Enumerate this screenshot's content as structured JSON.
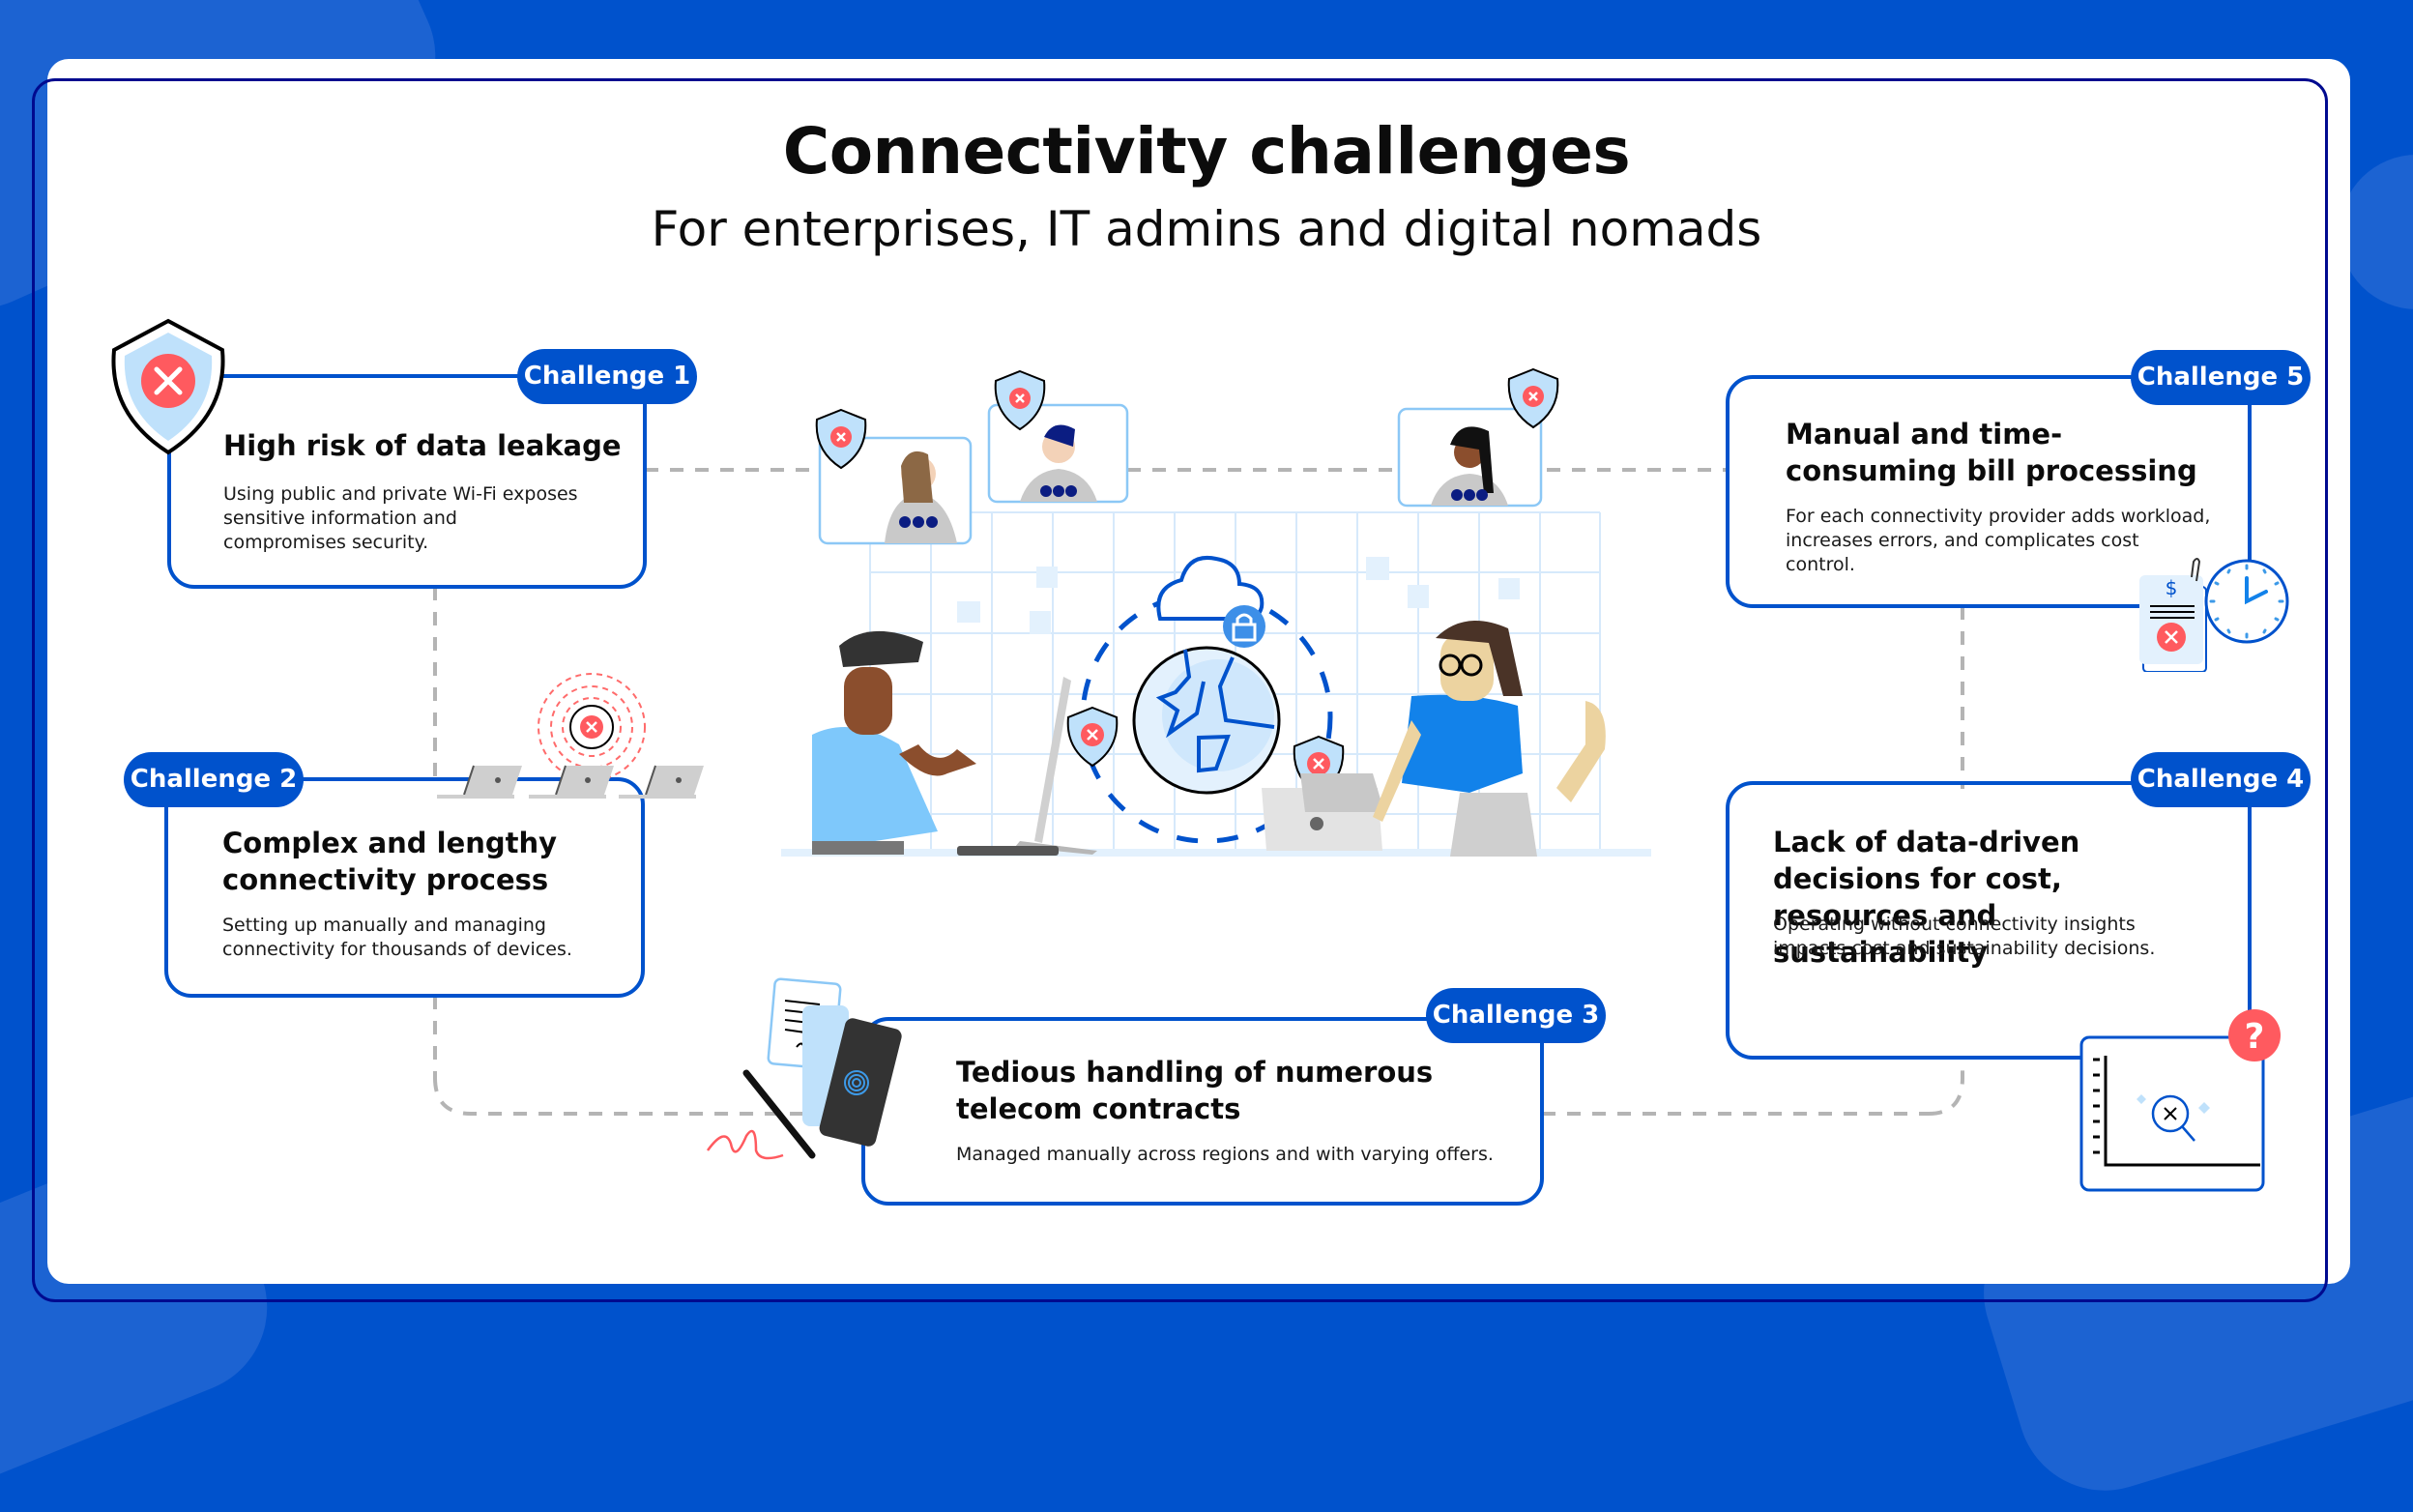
{
  "header": {
    "title": "Connectivity challenges",
    "subtitle": "For enterprises, IT admins and digital nomads"
  },
  "colors": {
    "background": "#0052cc",
    "card": "#ffffff",
    "frame": "#000a8f",
    "accent": "#0052cc",
    "alert": "#ff5a5f",
    "shield_fill": "#bfe1fb",
    "connector_dash": "#b4b4b4"
  },
  "challenges": [
    {
      "badge": "Challenge 1",
      "title": "High risk of data leakage",
      "description": "Using public and private Wi-Fi exposes sensitive information and compromises security.",
      "icon": "shield-alert-icon"
    },
    {
      "badge": "Challenge 2",
      "title": "Complex and lengthy connectivity process",
      "description": "Setting up manually and managing connectivity for thousands of devices.",
      "icon": "laptops-signal-alert-icon"
    },
    {
      "badge": "Challenge 3",
      "title": "Tedious handling of numerous telecom contracts",
      "description": "Managed manually across regions and with varying offers.",
      "icon": "contract-phone-icon"
    },
    {
      "badge": "Challenge 4",
      "title": "Lack of data-driven decisions for cost, resources and sustainability",
      "description": "Operating without connectivity insights impacts cost and sustainability decisions.",
      "icon": "chart-search-question-icon"
    },
    {
      "badge": "Challenge 5",
      "title": "Manual and time-consuming bill processing",
      "description": "For each connectivity provider adds workload, increases errors, and complicates cost control.",
      "icon": "bill-clock-icon"
    }
  ],
  "center_illustration": {
    "icons": [
      "cloud-icon",
      "lock-icon",
      "globe-icon",
      "shield-alert-icon",
      "video-call-frame",
      "person-laptop",
      "person-monitor"
    ],
    "bill_symbol": "$",
    "question_symbol": "?"
  }
}
